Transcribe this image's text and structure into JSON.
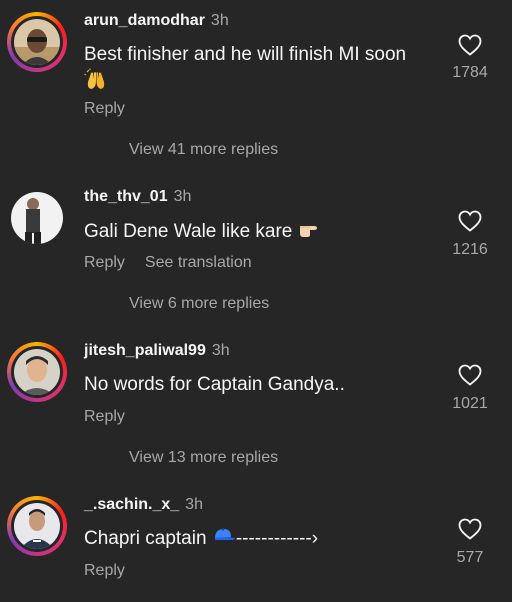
{
  "comments": [
    {
      "username": "arun_damodhar",
      "time": "3h",
      "text": "Best finisher and he will finish MI soon",
      "emoji": "raised-hands",
      "actions": [
        "Reply"
      ],
      "view_replies": "View 41 more replies",
      "likes": "1784"
    },
    {
      "username": "the_thv_01",
      "time": "3h",
      "text": "Gali Dene Wale like kare",
      "emoji": "pointing-hand",
      "actions": [
        "Reply",
        "See translation"
      ],
      "view_replies": "View 6 more replies",
      "likes": "1216"
    },
    {
      "username": "jitesh_paliwal99",
      "time": "3h",
      "text": "No words for Captain Gandya..",
      "emoji": "",
      "actions": [
        "Reply"
      ],
      "view_replies": "View 13 more replies",
      "likes": "1021"
    },
    {
      "username": "_.sachin._x_",
      "time": "3h",
      "text": "Chapri captain",
      "emoji": "blue-cap",
      "text_suffix": "------------›",
      "actions": [
        "Reply"
      ],
      "likes": "577"
    }
  ],
  "colors": {
    "background": "#262626",
    "primary_text": "#f5f5f5",
    "secondary_text": "#a8a8a8"
  }
}
